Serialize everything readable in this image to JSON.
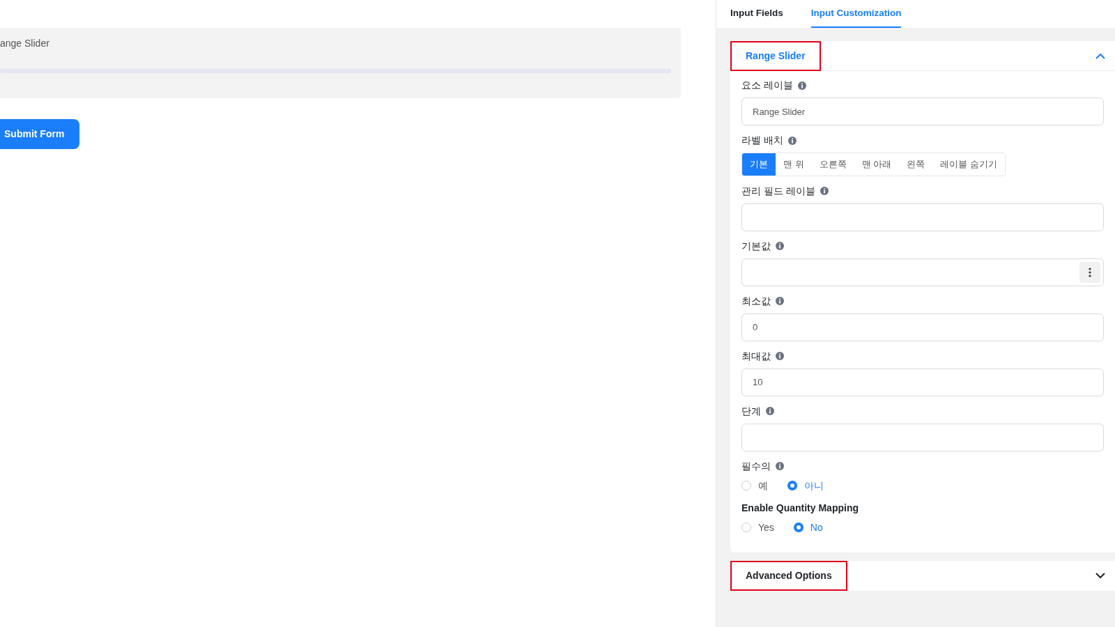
{
  "preview": {
    "field_label": "ange Slider",
    "submit_button": "Submit Form"
  },
  "tabs": [
    {
      "label": "Input Fields",
      "selected": false
    },
    {
      "label": "Input Customization",
      "selected": true
    }
  ],
  "sections": [
    {
      "title": "Range Slider",
      "expanded": true,
      "highlighted": true,
      "fields": [
        {
          "kind": "text",
          "label": "요소 레이블",
          "value": "Range Slider"
        },
        {
          "kind": "segmented",
          "label": "라벨 배치",
          "options": [
            {
              "label": "기본",
              "selected": true
            },
            {
              "label": "맨 위",
              "selected": false
            },
            {
              "label": "오른쪽",
              "selected": false
            },
            {
              "label": "맨 아래",
              "selected": false
            },
            {
              "label": "왼쪽",
              "selected": false
            },
            {
              "label": "레이블 숨기기",
              "selected": false
            }
          ]
        },
        {
          "kind": "text",
          "label": "관리 필드 레이블"
        },
        {
          "kind": "menu-text",
          "label": "기본값"
        },
        {
          "kind": "text",
          "label": "최소값",
          "value": "0"
        },
        {
          "kind": "text",
          "label": "최대값",
          "value": "10"
        },
        {
          "kind": "text",
          "label": "단계"
        },
        {
          "kind": "radio",
          "label": "필수의",
          "info": true,
          "options": [
            {
              "label": "예",
              "selected": false
            },
            {
              "label": "아니",
              "selected": true
            }
          ]
        },
        {
          "kind": "radio",
          "label": "Enable Quantity Mapping",
          "info": false,
          "bold": true,
          "options": [
            {
              "label": "Yes",
              "selected": false
            },
            {
              "label": "No",
              "selected": true
            }
          ]
        }
      ]
    },
    {
      "title": "Advanced Options",
      "expanded": false,
      "highlighted": true
    }
  ]
}
